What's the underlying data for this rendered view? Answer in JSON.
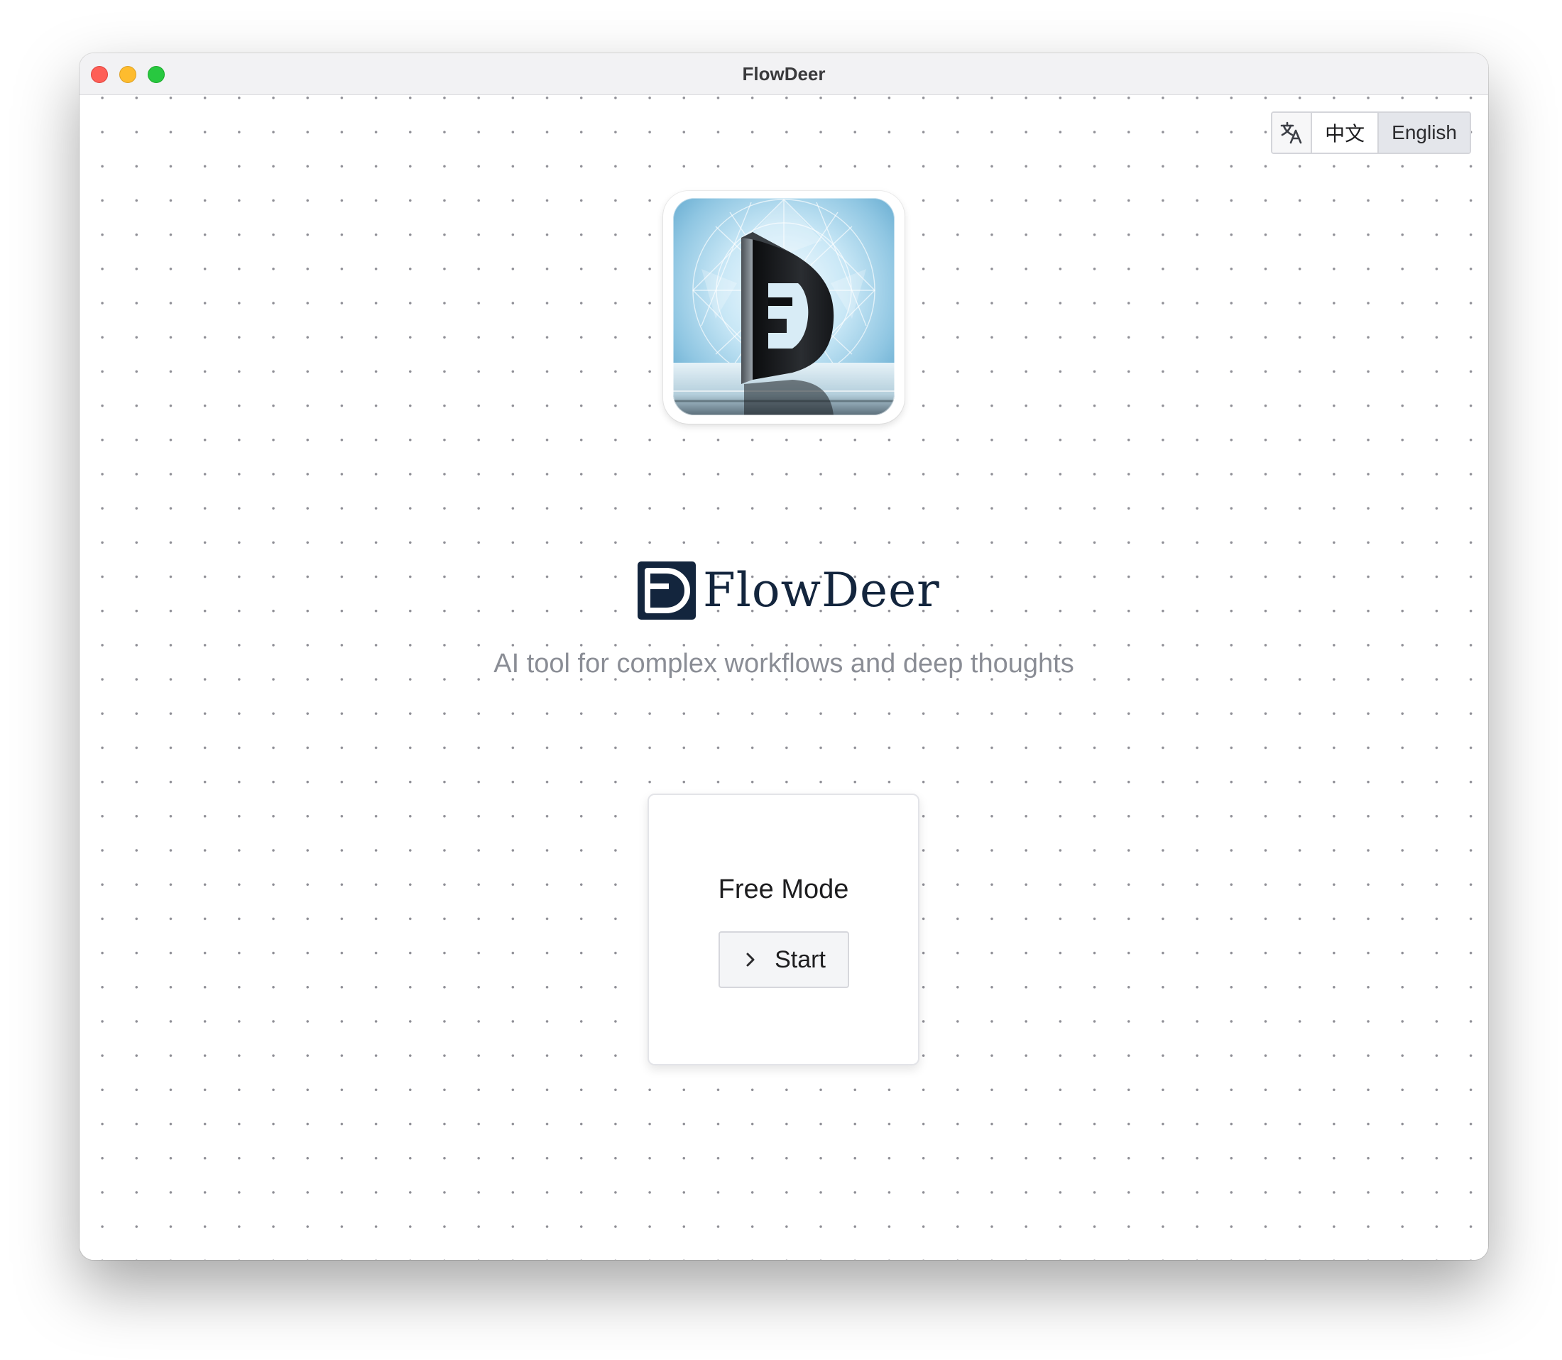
{
  "window": {
    "title": "FlowDeer",
    "controls": [
      "close",
      "minimize",
      "zoom"
    ]
  },
  "language_switcher": {
    "icon": "translate-icon",
    "options": [
      "中文",
      "English"
    ],
    "selected": "English"
  },
  "app_icon": {
    "name": "flowdeer-app-icon"
  },
  "brand": {
    "logo": "flowdeer-logo-mark",
    "name": "FlowDeer"
  },
  "tagline": "AI tool for complex workflows and deep thoughts",
  "modes": [
    {
      "title": "Free Mode",
      "button_label": "Start",
      "button_icon": "chevron-right-icon"
    }
  ],
  "colors": {
    "brand_navy": "#13253d",
    "tagline_gray": "#8a8d95",
    "selected_language_bg": "#e4e6eb",
    "traffic_close": "#fe5f57",
    "traffic_minimize": "#febc2e",
    "traffic_zoom": "#28c840"
  }
}
